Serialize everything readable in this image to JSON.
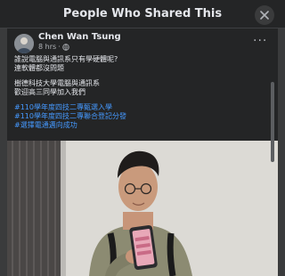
{
  "modal": {
    "title": "People Who Shared This"
  },
  "post": {
    "author": "Chen Wan Tsung",
    "time": "8 hrs",
    "separator": "·",
    "paragraph1": [
      "誰說電腦與通訊系只有學硬體呢?",
      "連軟體都沒問題"
    ],
    "paragraph2": [
      "樹德科技大學電腦與通訊系",
      "歡迎高三同學加入我們"
    ],
    "hashtags": [
      "#110學年度四技二專甄選入學",
      "#110學年度四技二專聯合登記分發",
      "#選擇電通邁向成功"
    ]
  },
  "icons": {
    "close": "close-icon",
    "globe": "globe-icon",
    "more": "more-icon"
  },
  "colors": {
    "background": "#3a3b3c",
    "card": "#242526",
    "text": "#e4e6eb",
    "secondary": "#b0b3b8",
    "hashtag": "#4599ff"
  }
}
